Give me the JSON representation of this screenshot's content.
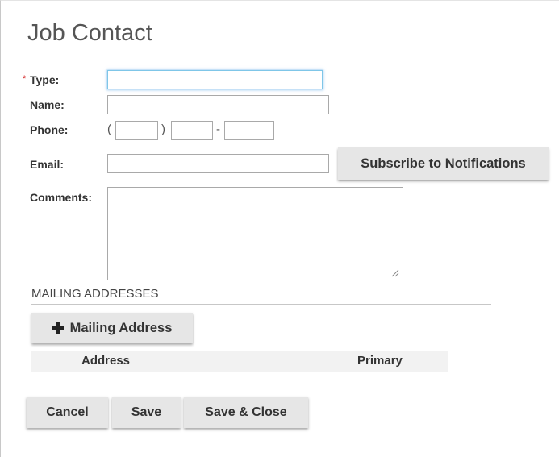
{
  "form": {
    "title": "Job Contact",
    "type_label": "Type:",
    "type_value": "",
    "required_mark": "*",
    "name_label": "Name:",
    "name_value": "",
    "phone_label": "Phone:",
    "phone_open_paren": "(",
    "phone_close_paren": ")",
    "phone_dash": "-",
    "phone_area": "",
    "phone_prefix": "",
    "phone_line": "",
    "email_label": "Email:",
    "email_value": "",
    "subscribe_label": "Subscribe to Notifications",
    "comments_label": "Comments:",
    "comments_value": ""
  },
  "mailing": {
    "section_title": "MAILING ADDRESSES",
    "add_button_label": "Mailing Address",
    "columns": [
      "Address",
      "Primary"
    ],
    "rows": []
  },
  "footer": {
    "cancel_label": "Cancel",
    "save_label": "Save",
    "save_close_label": "Save & Close"
  },
  "colors": {
    "button_bg": "#e6e6e6",
    "focus_border": "#7fc6e8",
    "required": "#cc0000",
    "title": "#555555"
  },
  "icons": {
    "add": "plus-icon",
    "resize": "resize-grip-icon"
  }
}
